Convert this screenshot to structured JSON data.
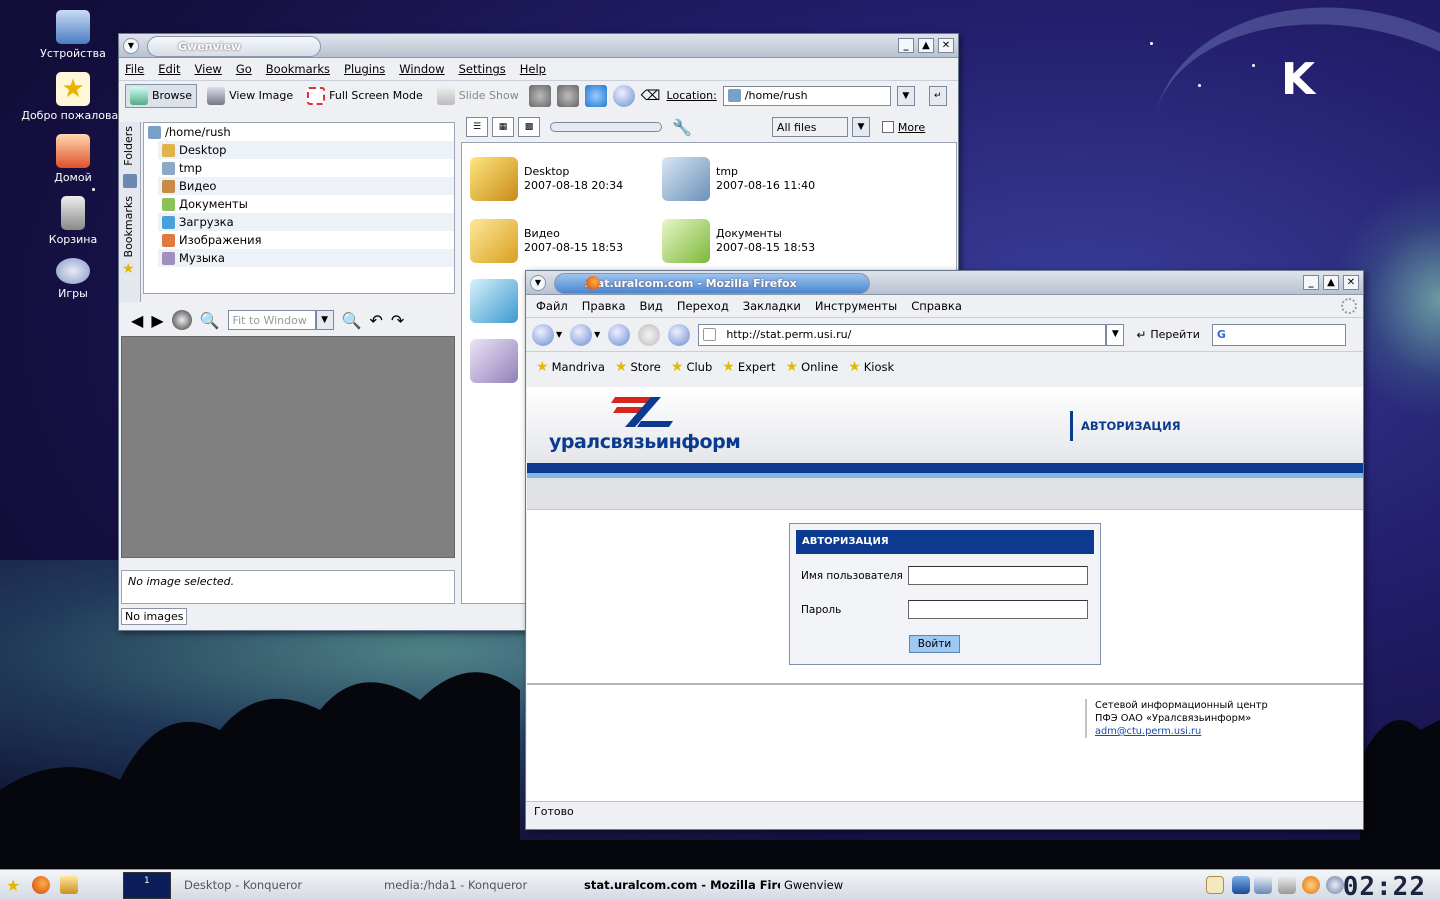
{
  "desktop": {
    "icons": [
      {
        "label": "Устройства",
        "icon": "computer-icon"
      },
      {
        "label": "Добро пожаловат",
        "icon": "welcome-star-icon"
      },
      {
        "label": "Домой",
        "icon": "home-icon"
      },
      {
        "label": "Корзина",
        "icon": "trash-icon"
      },
      {
        "label": "Игры",
        "icon": "gamepad-icon"
      }
    ],
    "logo_text": "K"
  },
  "gwenview": {
    "title": "Gwenview",
    "menu": [
      "File",
      "Edit",
      "View",
      "Go",
      "Bookmarks",
      "Plugins",
      "Window",
      "Settings",
      "Help"
    ],
    "toolbar": {
      "browse": "Browse",
      "view_image": "View Image",
      "full_screen": "Full Screen Mode",
      "slide_show": "Slide Show",
      "location_label": "Location:",
      "location_value": "/home/rush"
    },
    "side_tabs": {
      "folders": "Folders",
      "bookmarks": "Bookmarks"
    },
    "tree": {
      "root": "/home/rush",
      "items": [
        "Desktop",
        "tmp",
        "Видео",
        "Документы",
        "Загрузка",
        "Изображения",
        "Музыка"
      ]
    },
    "filter": {
      "value": "All files",
      "more": "More"
    },
    "fit_placeholder": "Fit to Window",
    "files": [
      {
        "name": "Desktop",
        "date": "2007-08-18 20:34"
      },
      {
        "name": "tmp",
        "date": "2007-08-16 11:40"
      },
      {
        "name": "Видео",
        "date": "2007-08-15 18:53"
      },
      {
        "name": "Документы",
        "date": "2007-08-15 18:53"
      }
    ],
    "info_text": "No image selected.",
    "status_text": "No images"
  },
  "firefox": {
    "title": "stat.uralcom.com - Mozilla Firefox",
    "menu": [
      "Файл",
      "Правка",
      "Вид",
      "Переход",
      "Закладки",
      "Инструменты",
      "Справка"
    ],
    "url": "http://stat.perm.usi.ru/",
    "go_label": "Перейти",
    "bookmarks": [
      "Mandriva",
      "Store",
      "Club",
      "Expert",
      "Online",
      "Kiosk"
    ],
    "page": {
      "logo_text": "уралсвязьинформ",
      "header_title": "АВТОРИЗАЦИЯ",
      "form_title": "АВТОРИЗАЦИЯ",
      "username_label": "Имя пользователя",
      "password_label": "Пароль",
      "submit_label": "Войти",
      "footer_line1": "Сетевой информационный центр",
      "footer_line2": "ПФЭ ОАО «Уралсвязьинформ»",
      "footer_email": "adm@ctu.perm.usi.ru"
    },
    "status_text": "Готово"
  },
  "taskbar": {
    "tasks": [
      "Desktop - Konqueror",
      "media:/hda1 - Konqueror",
      "stat.uralcom.com - Mozilla Firefo",
      "Gwenview"
    ],
    "pager_label": "1",
    "clock": "02:22"
  },
  "colors": {
    "usi_blue": "#0b3a8f",
    "usi_red": "#d8261c",
    "active_title": "#4a86d0"
  }
}
